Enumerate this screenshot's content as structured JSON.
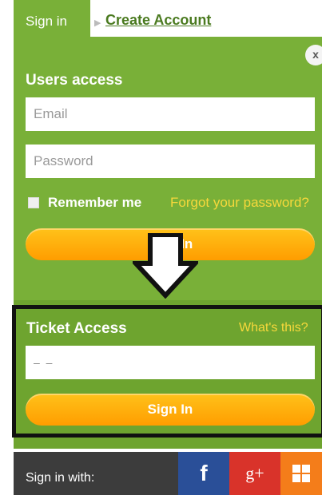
{
  "tabs": {
    "active": "Sign in",
    "link": "Create Account"
  },
  "close_label": "x",
  "users_access": {
    "title": "Users access",
    "email_placeholder": "Email",
    "password_placeholder": "Password",
    "remember_label": "Remember me",
    "forgot_label": "Forgot your password?",
    "sign_in_label": "Sign In"
  },
  "ticket_access": {
    "title": "Ticket Access",
    "whats_this": "What's this?",
    "ticket_value": "–  –",
    "sign_in_label": "Sign In"
  },
  "footer": {
    "label": "Sign in with:",
    "facebook": "f",
    "googleplus": "g+"
  },
  "colors": {
    "panel": "#79b038",
    "ticket_panel": "#6ea42f",
    "button": "#ffab0a",
    "accent_yellow": "#f6d83b",
    "footer": "#3c3c3c",
    "facebook": "#2a4f98",
    "googleplus": "#d9332a",
    "windows": "#f47d1a"
  },
  "icons": [
    "close-icon",
    "down-arrow-icon",
    "facebook-icon",
    "google-plus-icon",
    "windows-icon"
  ]
}
